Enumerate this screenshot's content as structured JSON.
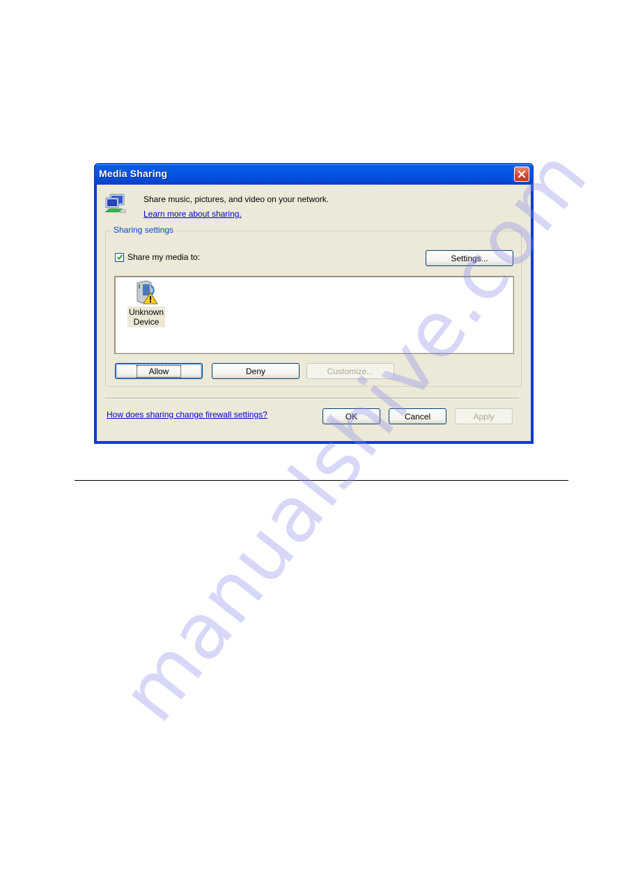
{
  "dialog": {
    "title": "Media Sharing",
    "close_icon": "close-icon",
    "intro": "Share music, pictures, and video on your network.",
    "learn_more_link": "Learn more about sharing.",
    "sharing_settings": {
      "group_label": "Sharing settings",
      "share_checkbox": {
        "label": "Share my media to:",
        "checked": true
      },
      "settings_button": "Settings...",
      "devices": [
        {
          "name_line1": "Unknown",
          "name_line2": "Device",
          "icon": "unknown-device-warning-icon"
        }
      ],
      "allow_button": "Allow",
      "deny_button": "Deny",
      "customize_button": "Customize..."
    },
    "firewall_link": "How does sharing change firewall settings?",
    "ok_button": "OK",
    "cancel_button": "Cancel",
    "apply_button": "Apply"
  },
  "watermark": "manualshive.com",
  "colors": {
    "titlebar": "#0553e0",
    "dialog_bg": "#ece9d8",
    "group_label": "#0046d5",
    "link": "#0000cc",
    "checkmark": "#21a121"
  }
}
